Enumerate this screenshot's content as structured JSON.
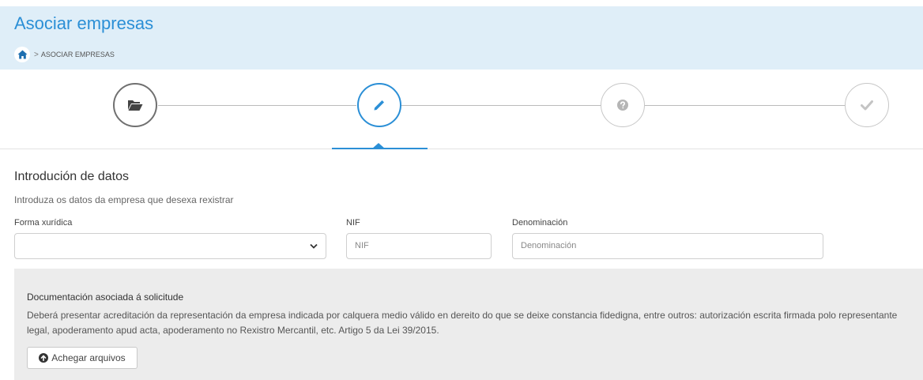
{
  "header": {
    "title": "Asociar empresas",
    "breadcrumb": {
      "home_icon": "home-icon",
      "separator": ">",
      "current": "ASOCIAR EMPRESAS"
    }
  },
  "stepper": {
    "steps": [
      {
        "icon": "folder-open-icon",
        "state": "completed"
      },
      {
        "icon": "pencil-icon",
        "state": "active"
      },
      {
        "icon": "question-circle-icon",
        "state": "pending"
      },
      {
        "icon": "check-icon",
        "state": "pending"
      }
    ],
    "active_index": 1
  },
  "form": {
    "section_title": "Introdución de datos",
    "section_description": "Introduza os datos da empresa que desexa rexistrar",
    "forma_xuridica": {
      "label": "Forma xurídica",
      "value": ""
    },
    "nif": {
      "label": "NIF",
      "placeholder": "NIF"
    },
    "denominacion": {
      "label": "Denominación",
      "placeholder": "Denominación"
    }
  },
  "documentation": {
    "title": "Documentación asociada á solicitude",
    "text": "Deberá presentar acreditación da representación da empresa indicada por calquera medio válido en dereito do que se deixe constancia fidedigna, entre outros: autorización escrita firmada polo representante legal, apoderamento apud acta, apoderamento no Rexistro Mercantil, etc. Artigo 5 da Lei 39/2015.",
    "attach_button_label": "Achegar arquivos"
  },
  "colors": {
    "accent": "#2b8fd6",
    "header_bg": "#dfeef8",
    "panel_bg": "#ececec"
  }
}
